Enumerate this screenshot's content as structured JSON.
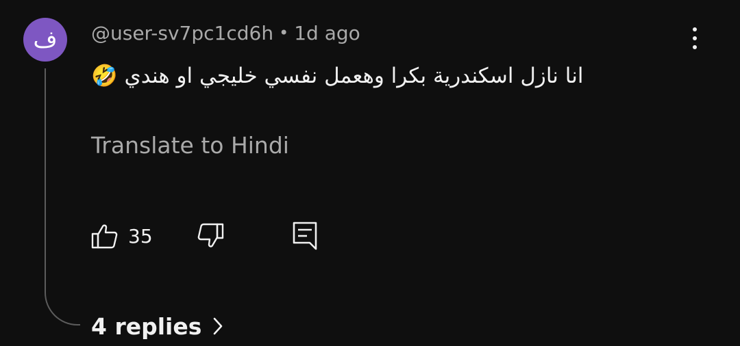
{
  "comment": {
    "avatar_initial": "ف",
    "avatar_color": "#7e57c2",
    "username": "@user-sv7pc1cd6h",
    "separator": "•",
    "time_ago": "1d ago",
    "text": "انا نازل اسكندرية بكرا وهعمل نفسي خليجي او هندي 🤣",
    "translate_label": "Translate to Hindi",
    "like_count": "35",
    "replies_label": "4 replies"
  },
  "icons": {
    "like": "thumbs-up-icon",
    "dislike": "thumbs-down-icon",
    "reply": "comment-reply-icon",
    "more": "more-vertical-icon",
    "replies_chevron": "chevron-right-icon"
  }
}
